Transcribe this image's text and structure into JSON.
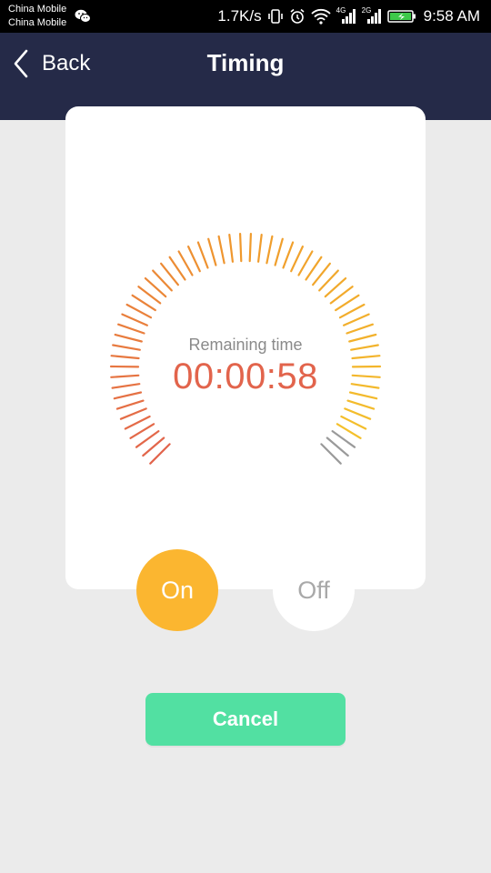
{
  "status_bar": {
    "carrier_1": "China Mobile",
    "carrier_2": "China Mobile",
    "speed": "1.7K/s",
    "signal_1_tag": "4G",
    "signal_2_tag": "2G",
    "time": "9:58 AM",
    "icons": [
      "wechat-icon",
      "vibrate-icon",
      "alarm-icon",
      "wifi-icon",
      "signal-icon",
      "battery-charging-icon"
    ]
  },
  "header": {
    "back_label": "Back",
    "title": "Timing",
    "background": "#252a48"
  },
  "timer": {
    "label": "Remaining time",
    "value": "00:00:58",
    "value_color": "#e2644c",
    "gradient_colors": [
      "#e2644c",
      "#f09a2c",
      "#f4c42c"
    ],
    "inactive_tick_color": "#9a9a9a",
    "inactive_ticks": 3
  },
  "toggle": {
    "on_label": "On",
    "off_label": "Off",
    "selected": "On",
    "on_color": "#fbb630"
  },
  "actions": {
    "cancel_label": "Cancel",
    "cancel_color": "#52e0a2"
  }
}
